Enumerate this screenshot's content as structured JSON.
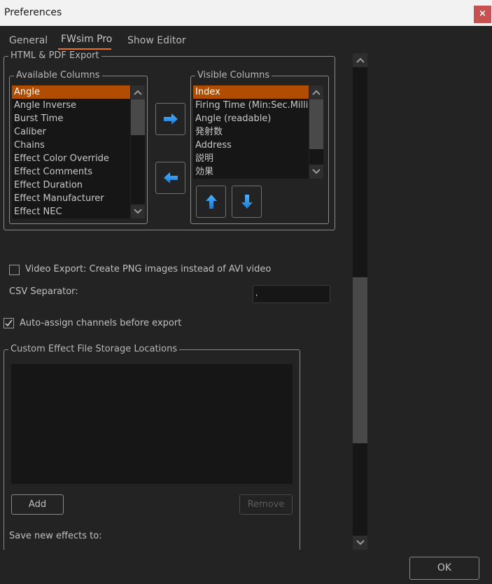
{
  "window": {
    "title": "Preferences",
    "close_glyph": "×"
  },
  "tabs": [
    {
      "label": "General",
      "active": false
    },
    {
      "label": "FWsim Pro",
      "active": true
    },
    {
      "label": "Show Editor",
      "active": false
    }
  ],
  "html_pdf_export": {
    "title": "HTML & PDF Export",
    "available_columns": {
      "title": "Available Columns",
      "items": [
        "Angle",
        "Angle Inverse",
        "Burst Time",
        "Caliber",
        "Chains",
        "Effect Color Override",
        "Effect Comments",
        "Effect Duration",
        "Effect Manufacturer",
        "Effect NEC"
      ],
      "selected_index": 0
    },
    "visible_columns": {
      "title": "Visible Columns",
      "items": [
        "Index",
        "Firing Time (Min:Sec.Milliseconds)",
        "Angle (readable)",
        "発射数",
        "Address",
        "説明",
        "効果"
      ],
      "selected_index": 0
    },
    "buttons": {
      "add_icon": "arrow-right-icon",
      "remove_icon": "arrow-left-icon",
      "move_up_icon": "arrow-up-icon",
      "move_down_icon": "arrow-down-icon"
    }
  },
  "video_export": {
    "label": "Video Export: Create PNG images instead of AVI video",
    "checked": false
  },
  "csv_separator": {
    "label": "CSV Separator:",
    "value": ","
  },
  "auto_assign": {
    "label": "Auto-assign channels before export",
    "checked": true
  },
  "custom_effect_storage": {
    "title": "Custom Effect File Storage Locations",
    "items": [],
    "add_label": "Add",
    "remove_label": "Remove",
    "save_new_label": "Save new effects to:"
  },
  "footer": {
    "ok_label": "OK"
  },
  "colors": {
    "accent_tab": "#e8731a",
    "selection": "#b04d00",
    "close": "#c75050",
    "arrow": "#2196f3"
  }
}
